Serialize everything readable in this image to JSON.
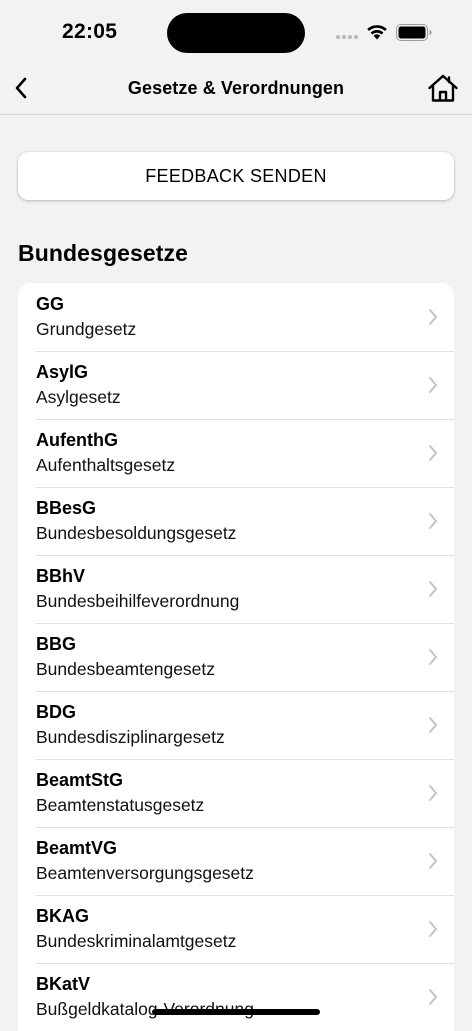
{
  "status_bar": {
    "time": "22:05",
    "icons": [
      "signal-dots-icon",
      "wifi-icon",
      "battery-icon"
    ]
  },
  "nav": {
    "title": "Gesetze & Verordnungen",
    "back_icon": "chevron-left-icon",
    "home_icon": "home-icon"
  },
  "feedback_button": {
    "label": "FEEDBACK SENDEN"
  },
  "section": {
    "title": "Bundesgesetze"
  },
  "laws": [
    {
      "abbr": "GG",
      "name": "Grundgesetz"
    },
    {
      "abbr": "AsylG",
      "name": "Asylgesetz"
    },
    {
      "abbr": "AufenthG",
      "name": "Aufenthaltsgesetz"
    },
    {
      "abbr": "BBesG",
      "name": "Bundesbesoldungsgesetz"
    },
    {
      "abbr": "BBhV",
      "name": "Bundesbeihilfeverordnung"
    },
    {
      "abbr": "BBG",
      "name": "Bundesbeamtengesetz"
    },
    {
      "abbr": "BDG",
      "name": "Bundesdisziplinargesetz"
    },
    {
      "abbr": "BeamtStG",
      "name": "Beamtenstatusgesetz"
    },
    {
      "abbr": "BeamtVG",
      "name": "Beamtenversorgungsgesetz"
    },
    {
      "abbr": "BKAG",
      "name": "Bundeskriminalamtgesetz"
    },
    {
      "abbr": "BKatV",
      "name": "Bußgeldkatalog-Verordnung"
    }
  ],
  "colors": {
    "background": "#f2f2f4",
    "card": "#ffffff",
    "separator": "#e0e0e3",
    "chevron": "#c4c4c7",
    "text": "#000000"
  }
}
